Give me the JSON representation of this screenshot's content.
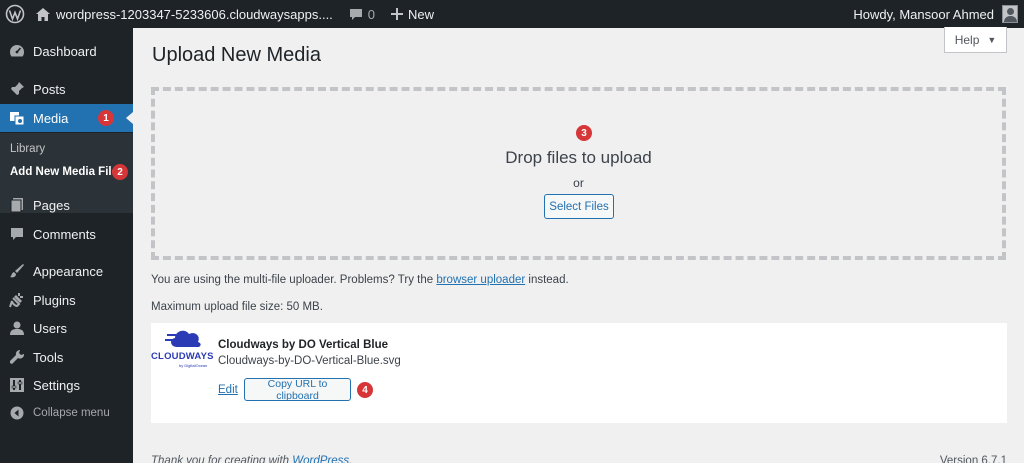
{
  "adminbar": {
    "site_name": "wordpress-1203347-5233606.cloudwaysapps....",
    "comments_count": "0",
    "new_label": "New",
    "greeting": "Howdy, Mansoor Ahmed"
  },
  "sidebar": {
    "items": [
      {
        "label": "Dashboard",
        "icon": "dashboard-icon"
      },
      {
        "label": "Posts",
        "icon": "pin-icon"
      },
      {
        "label": "Media",
        "icon": "media-icon",
        "badge": "1"
      },
      {
        "label": "Pages",
        "icon": "page-icon"
      },
      {
        "label": "Comments",
        "icon": "comment-icon"
      },
      {
        "label": "Appearance",
        "icon": "brush-icon"
      },
      {
        "label": "Plugins",
        "icon": "plugin-icon"
      },
      {
        "label": "Users",
        "icon": "user-icon"
      },
      {
        "label": "Tools",
        "icon": "wrench-icon"
      },
      {
        "label": "Settings",
        "icon": "settings-icon"
      }
    ],
    "submenu": {
      "library": "Library",
      "add_new": "Add New Media File",
      "add_new_badge": "2"
    },
    "collapse_label": "Collapse menu"
  },
  "help_label": "Help",
  "page_title": "Upload New Media",
  "dropzone": {
    "badge": "3",
    "title": "Drop files to upload",
    "or": "or",
    "button": "Select Files"
  },
  "uploader_info": {
    "text_before": "You are using the multi-file uploader. Problems? Try the",
    "link": "browser uploader",
    "text_after": "instead."
  },
  "max_upload": "Maximum upload file size: 50 MB.",
  "media_item": {
    "thumb_word": "CLOUDWAYS",
    "thumb_sub": "by DigitalOcean",
    "title": "Cloudways by DO Vertical Blue",
    "filename": "Cloudways-by-DO-Vertical-Blue.svg",
    "edit": "Edit",
    "copy_button": "Copy URL to clipboard",
    "badge": "4"
  },
  "footer": {
    "thanks_before": "Thank you for creating with",
    "thanks_link": "WordPress",
    "thanks_after": ".",
    "version": "Version 6.7.1"
  },
  "colors": {
    "adminbar_bg": "#1d2327",
    "accent": "#2271b1",
    "badge_red": "#d63638",
    "background": "#f0f0f1"
  }
}
